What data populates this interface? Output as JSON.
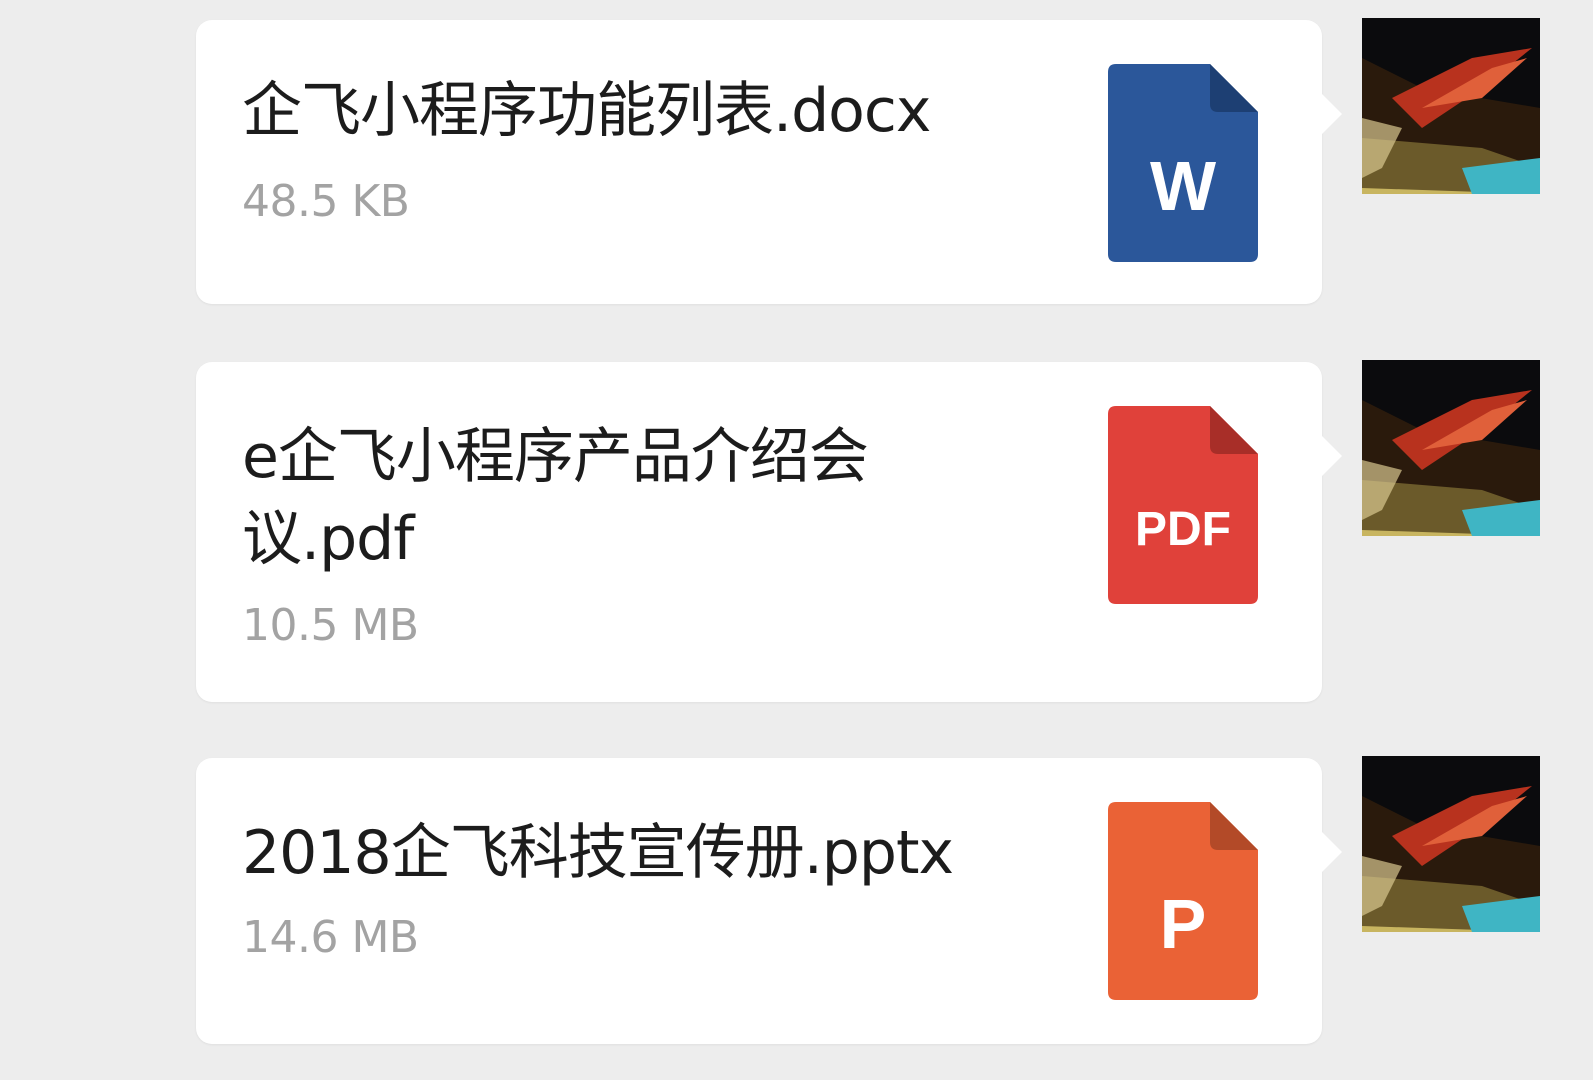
{
  "messages": [
    {
      "file_name": "企飞小程序功能列表.docx",
      "file_size": "48.5 KB",
      "icon": {
        "name": "word-file-icon",
        "label": "W",
        "color": "#2b579a",
        "fold": "#1d3f73"
      }
    },
    {
      "file_name": "e企飞小程序产品介绍会议.pdf",
      "file_size": "10.5 MB",
      "icon": {
        "name": "pdf-file-icon",
        "label": "PDF",
        "color": "#e0413a",
        "fold": "#a82e28"
      }
    },
    {
      "file_name": "2018企飞科技宣传册.pptx",
      "file_size": "14.6 MB",
      "icon": {
        "name": "powerpoint-file-icon",
        "label": "P",
        "color": "#ea6236",
        "fold": "#b34a28"
      }
    }
  ]
}
